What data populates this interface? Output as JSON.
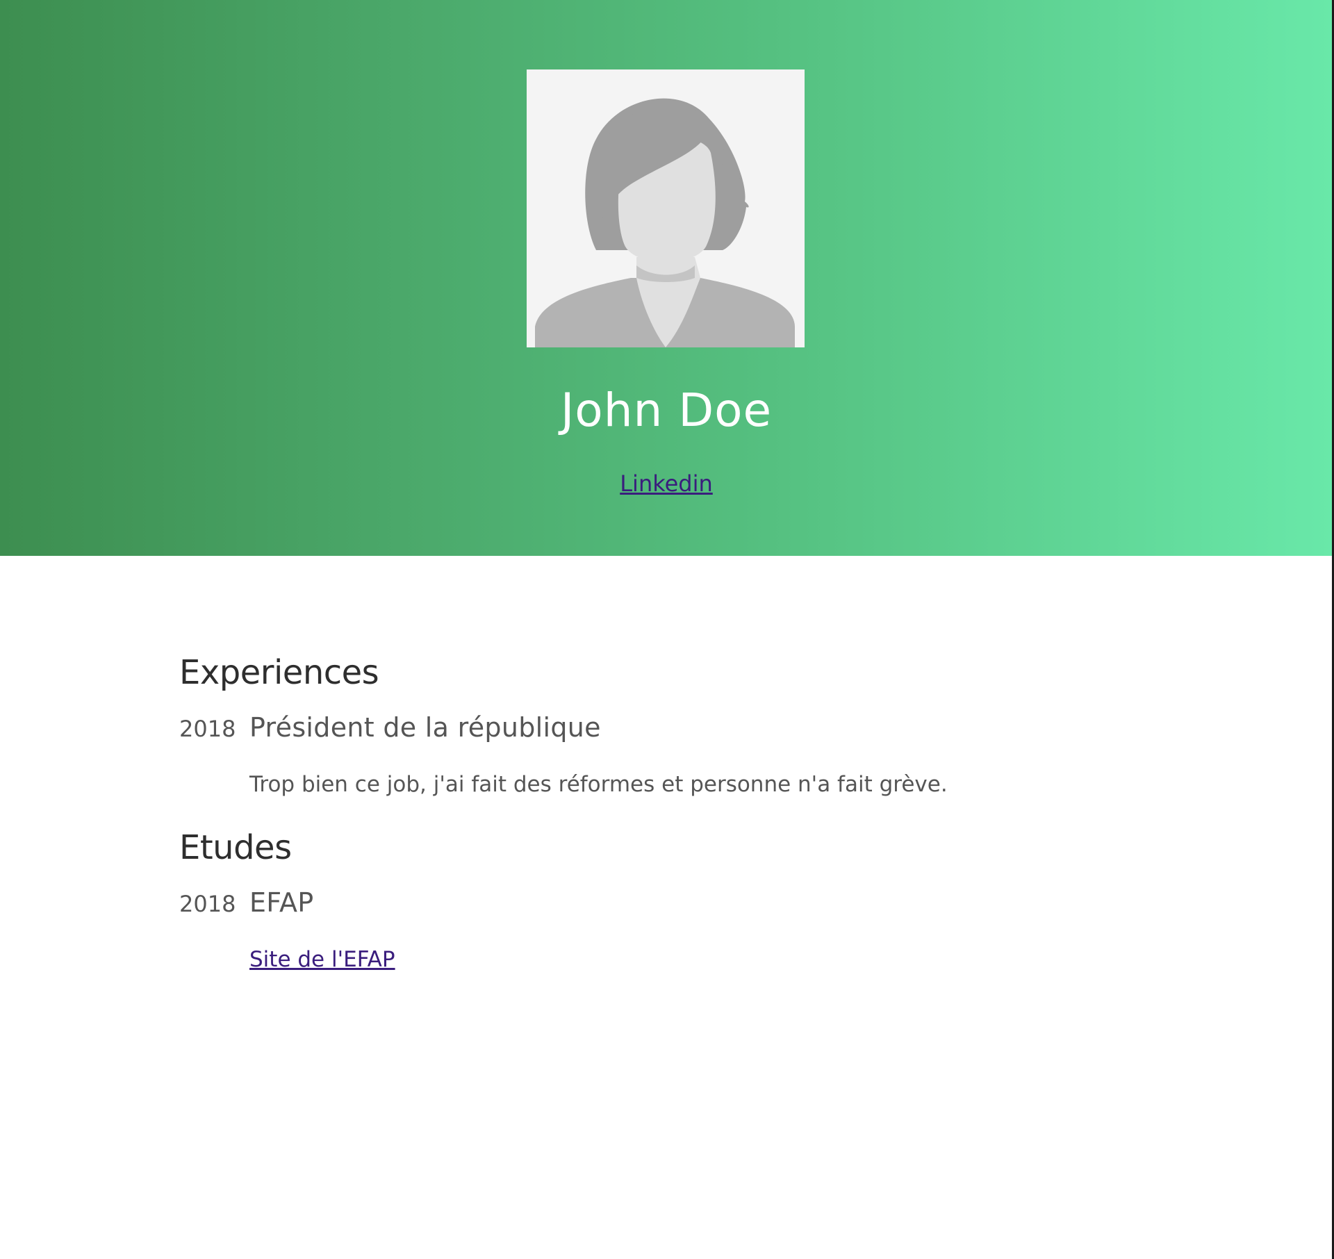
{
  "header": {
    "name": "John Doe",
    "link_label": "Linkedin",
    "gradient_colors": [
      "#3d8e50",
      "#69e8a9"
    ]
  },
  "avatar": {
    "icon": "user-placeholder-icon"
  },
  "sections": {
    "experiences": {
      "title": "Experiences",
      "items": [
        {
          "year": "2018",
          "title": "Président de la république",
          "description": "Trop bien ce job, j'ai fait des réformes et personne n'a fait grève."
        }
      ]
    },
    "etudes": {
      "title": "Etudes",
      "items": [
        {
          "year": "2018",
          "title": "EFAP",
          "link_label": "Site de l'EFAP"
        }
      ]
    }
  },
  "colors": {
    "link": "#3a1d7d",
    "heading": "#2e2e2e",
    "body_text": "#555555"
  }
}
